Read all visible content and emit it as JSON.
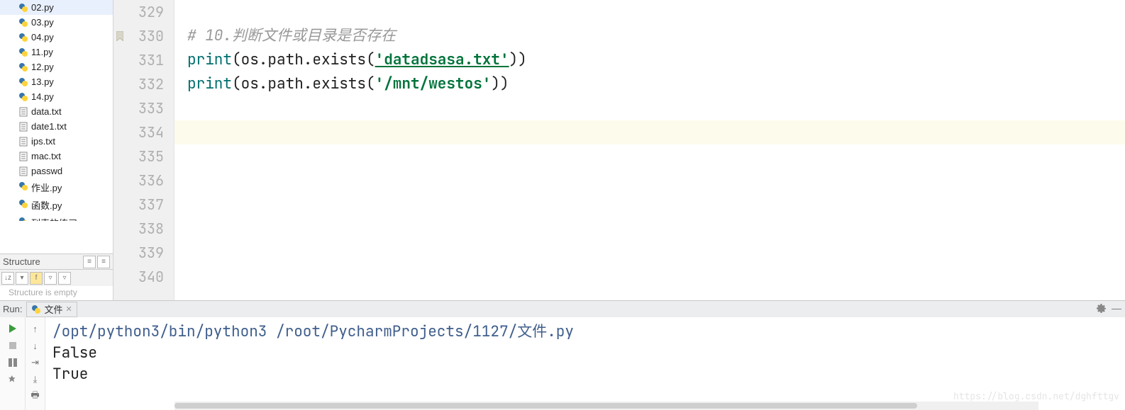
{
  "files": [
    {
      "name": "02.py",
      "kind": "py"
    },
    {
      "name": "03.py",
      "kind": "py"
    },
    {
      "name": "04.py",
      "kind": "py"
    },
    {
      "name": "11.py",
      "kind": "py"
    },
    {
      "name": "12.py",
      "kind": "py"
    },
    {
      "name": "13.py",
      "kind": "py"
    },
    {
      "name": "14.py",
      "kind": "py"
    },
    {
      "name": "data.txt",
      "kind": "txt"
    },
    {
      "name": "date1.txt",
      "kind": "txt"
    },
    {
      "name": "ips.txt",
      "kind": "txt"
    },
    {
      "name": "mac.txt",
      "kind": "txt"
    },
    {
      "name": "passwd",
      "kind": "txt"
    },
    {
      "name": "作业.py",
      "kind": "py"
    },
    {
      "name": "函数.py",
      "kind": "py"
    },
    {
      "name": "列表的练习",
      "kind": "py",
      "cut": true
    }
  ],
  "structure": {
    "label": "Structure",
    "empty": "Structure is empty"
  },
  "gutter": {
    "start": 329,
    "end": 340,
    "current": 334,
    "bookmark": 330
  },
  "code": {
    "l329": "",
    "l330_comment": "# 10.判断文件或目录是否存在",
    "l331_print": "print",
    "l331_mid": "(os.path.exists(",
    "l331_str": "'datadsasa.txt'",
    "l331_end": "))",
    "l332_print": "print",
    "l332_mid": "(os.path.exists(",
    "l332_str": "'/mnt/westos'",
    "l332_end": "))"
  },
  "run": {
    "label": "Run:",
    "tab_name": "文件"
  },
  "console": {
    "cmd": "/opt/python3/bin/python3 /root/PycharmProjects/1127/文件.py",
    "out1": "False",
    "out2": "True"
  },
  "watermark": "https://blog.csdn.net/dghfttgv"
}
